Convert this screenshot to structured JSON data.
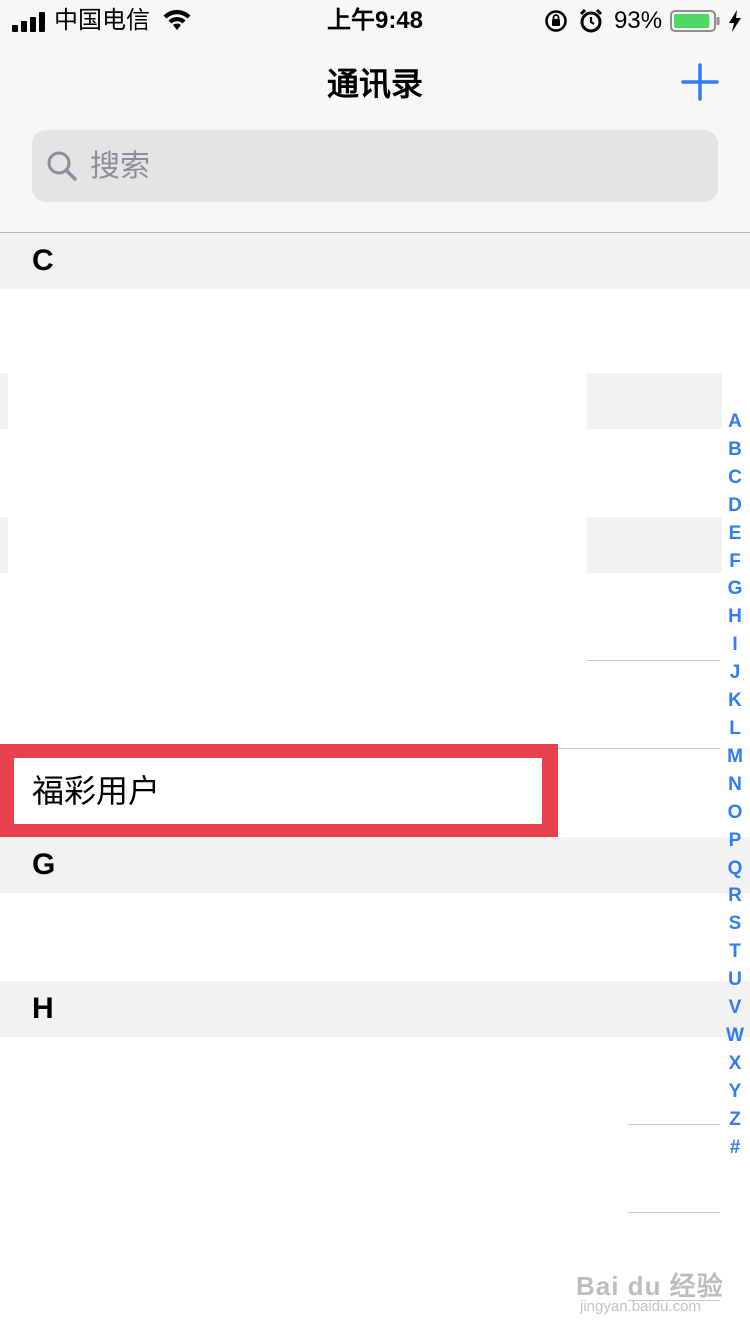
{
  "status_bar": {
    "carrier": "中国电信",
    "time": "上午9:48",
    "battery_percent": "93%",
    "battery_level": 0.93,
    "icons": [
      "signal-icon",
      "wifi-icon",
      "orientation-lock-icon",
      "alarm-icon",
      "battery-icon",
      "charging-icon"
    ]
  },
  "nav": {
    "title": "通讯录",
    "add_icon": "plus-icon"
  },
  "search": {
    "placeholder": "搜索",
    "value": ""
  },
  "sections": [
    {
      "letter": "C"
    },
    {
      "letter": "G"
    },
    {
      "letter": "H"
    }
  ],
  "contacts": [
    {
      "name": "福彩用户",
      "section": "C",
      "highlighted": true
    }
  ],
  "index": [
    "A",
    "B",
    "C",
    "D",
    "E",
    "F",
    "G",
    "H",
    "I",
    "J",
    "K",
    "L",
    "M",
    "N",
    "O",
    "P",
    "Q",
    "R",
    "S",
    "T",
    "U",
    "V",
    "W",
    "X",
    "Y",
    "Z",
    "#"
  ],
  "colors": {
    "accent": "#2f7cf6",
    "highlight": "#e8414d",
    "header_bg": "#f2f2f2",
    "bar_bg": "#f7f7f7"
  },
  "watermark": {
    "main": "Bai du 经验",
    "sub": "jingyan.baidu.com"
  }
}
